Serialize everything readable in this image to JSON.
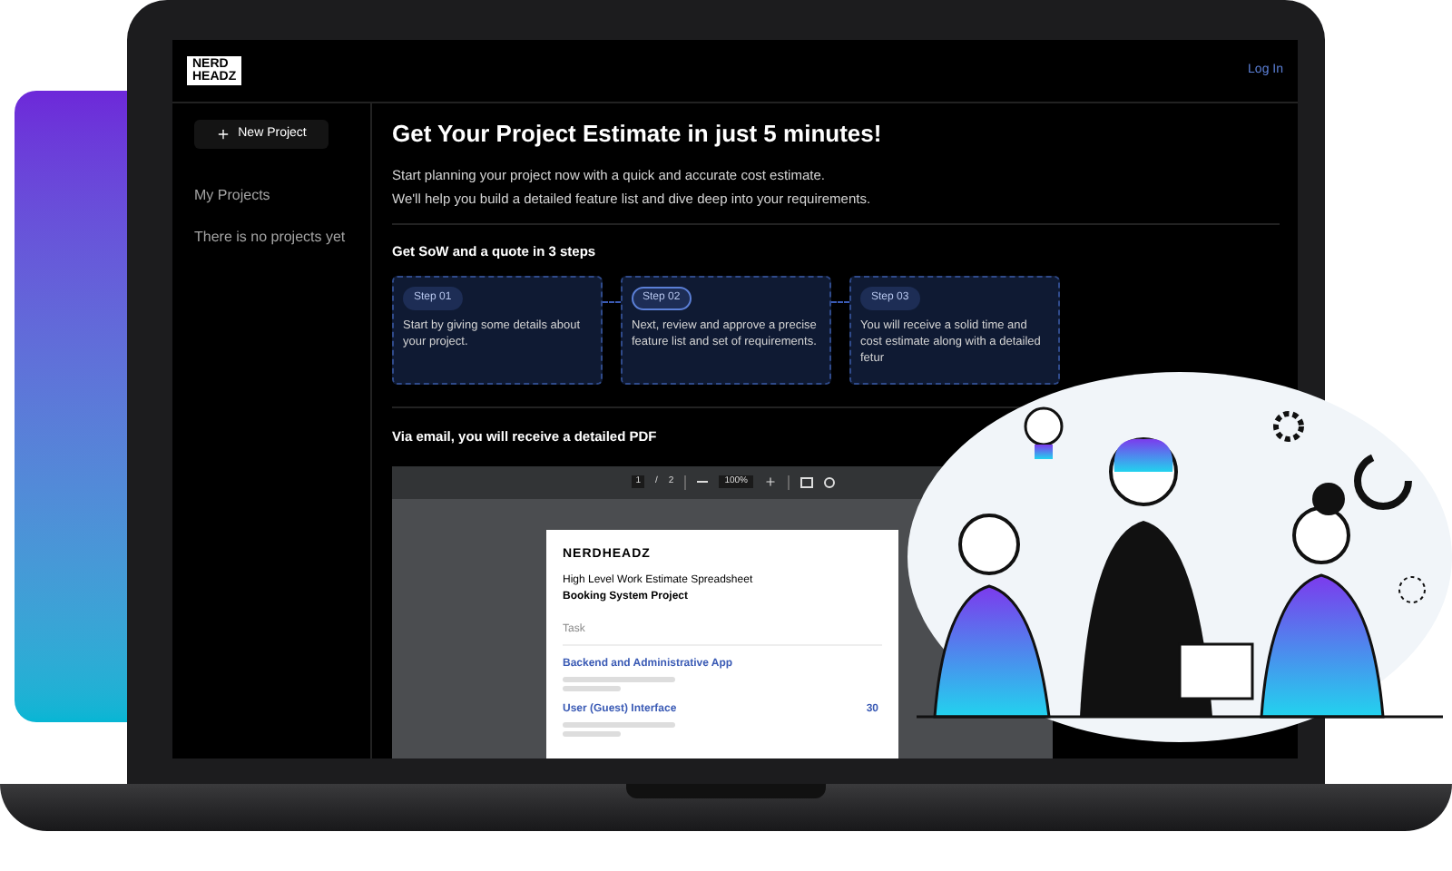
{
  "header": {
    "logo_lines": [
      "NERD",
      "HEADZ"
    ],
    "login_link": "Log In"
  },
  "sidebar": {
    "new_project_button": "New Project",
    "section_title": "My Projects",
    "empty_message": "There is no projects yet"
  },
  "main": {
    "title": "Get Your Project Estimate in just 5 minutes!",
    "intro": [
      "Start planning your project now with a quick and accurate cost estimate.",
      "We'll help you build a detailed feature list and dive deep into your requirements."
    ],
    "steps_heading": "Get SoW and a quote in 3 steps",
    "steps": [
      {
        "badge": "Step 01",
        "text": "Start by giving some details about your project.",
        "selected": false
      },
      {
        "badge": "Step 02",
        "text": "Next, review and approve a precise feature list and set of requirements.",
        "selected": true
      },
      {
        "badge": "Step 03",
        "text": "You will receive a solid time and cost estimate along with a detailed fetur",
        "selected": false
      }
    ],
    "pdf_heading": "Via email, you will receive a detailed PDF",
    "pdf_viewer": {
      "page_current": "1",
      "page_separator": "/",
      "page_total": "2",
      "zoom": "100%",
      "document": {
        "logo": "NERDHEADZ",
        "title": "High Level Work Estimate Spreadsheet",
        "subtitle": "Booking System Project",
        "column": "Task",
        "rows": [
          {
            "name": "Backend and Administrative App"
          },
          {
            "name": "User (Guest) Interface",
            "value": "30"
          }
        ]
      }
    }
  }
}
